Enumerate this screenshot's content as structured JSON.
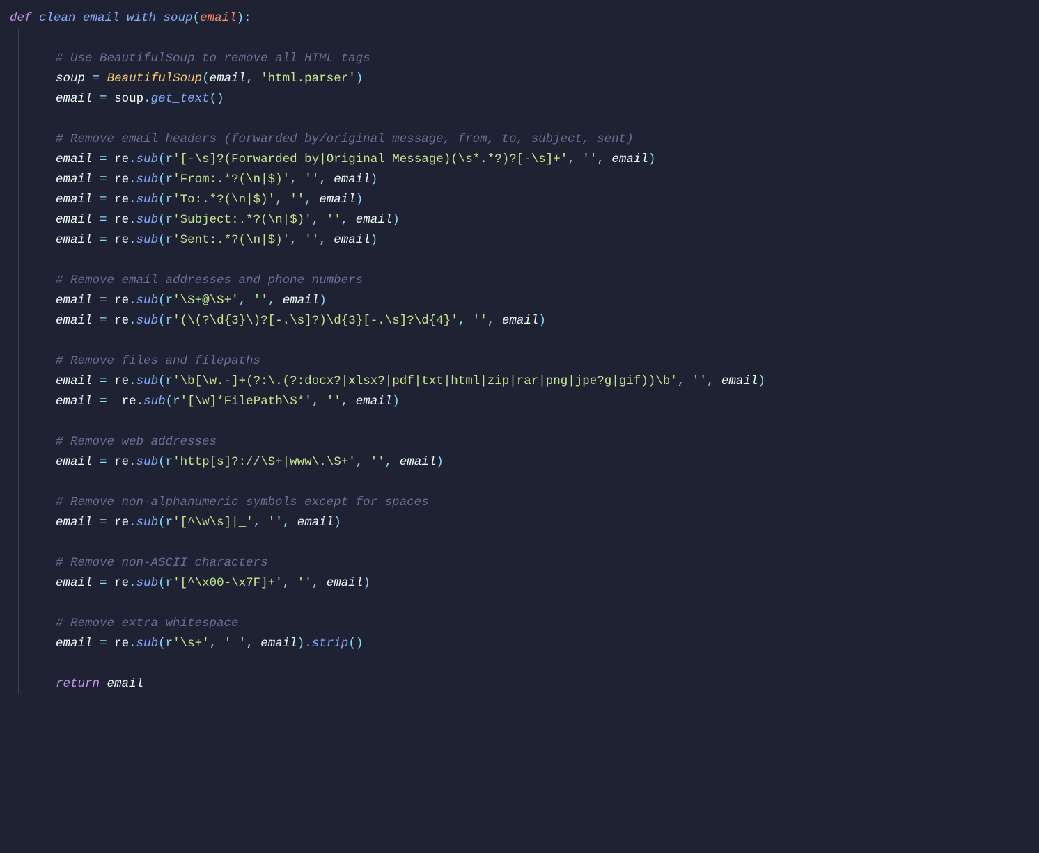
{
  "colors": {
    "background": "#1f2233",
    "keyword": "#c792ea",
    "function": "#82aaff",
    "class": "#ffcb6b",
    "param": "#f78c6c",
    "string": "#c3e88d",
    "punct": "#89ddff",
    "comment": "#697098",
    "text": "#eeffff"
  },
  "code": {
    "lang": "python",
    "def_kw": "def",
    "func_name": "clean_email_with_soup",
    "func_param": "email",
    "return_kw": "return",
    "return_var": "email",
    "lines": [
      {
        "type": "blank"
      },
      {
        "type": "comment",
        "text": "# Use BeautifulSoup to remove all HTML tags"
      },
      {
        "type": "assign",
        "lhs": "soup",
        "rhs_obj": "BeautifulSoup",
        "rhs_obj_kind": "cls",
        "args": [
          {
            "kind": "var",
            "v": "email"
          },
          {
            "kind": "str",
            "v": "'html.parser'"
          }
        ]
      },
      {
        "type": "assign",
        "lhs": "email",
        "rhs_obj": "soup",
        "rhs_method": "get_text",
        "args": []
      },
      {
        "type": "blank"
      },
      {
        "type": "comment",
        "text": "# Remove email headers (forwarded by/original message, from, to, subject, sent)"
      },
      {
        "type": "assign",
        "lhs": "email",
        "rhs_obj": "re",
        "rhs_method": "sub",
        "args": [
          {
            "kind": "rstr",
            "v": "'[-\\s]?(Forwarded by|Original Message)(\\s*.*?)?[-\\s]+'"
          },
          {
            "kind": "str",
            "v": "''"
          },
          {
            "kind": "var",
            "v": "email"
          }
        ]
      },
      {
        "type": "assign",
        "lhs": "email",
        "rhs_obj": "re",
        "rhs_method": "sub",
        "args": [
          {
            "kind": "rstr",
            "v": "'From:.*?(\\n|$)'"
          },
          {
            "kind": "str",
            "v": "''"
          },
          {
            "kind": "var",
            "v": "email"
          }
        ]
      },
      {
        "type": "assign",
        "lhs": "email",
        "rhs_obj": "re",
        "rhs_method": "sub",
        "args": [
          {
            "kind": "rstr",
            "v": "'To:.*?(\\n|$)'"
          },
          {
            "kind": "str",
            "v": "''"
          },
          {
            "kind": "var",
            "v": "email"
          }
        ]
      },
      {
        "type": "assign",
        "lhs": "email",
        "rhs_obj": "re",
        "rhs_method": "sub",
        "args": [
          {
            "kind": "rstr",
            "v": "'Subject:.*?(\\n|$)'"
          },
          {
            "kind": "str",
            "v": "''"
          },
          {
            "kind": "var",
            "v": "email"
          }
        ]
      },
      {
        "type": "assign",
        "lhs": "email",
        "rhs_obj": "re",
        "rhs_method": "sub",
        "args": [
          {
            "kind": "rstr",
            "v": "'Sent:.*?(\\n|$)'"
          },
          {
            "kind": "str",
            "v": "''"
          },
          {
            "kind": "var",
            "v": "email"
          }
        ]
      },
      {
        "type": "blank"
      },
      {
        "type": "comment",
        "text": "# Remove email addresses and phone numbers"
      },
      {
        "type": "assign",
        "lhs": "email",
        "rhs_obj": "re",
        "rhs_method": "sub",
        "args": [
          {
            "kind": "rstr",
            "v": "'\\S+@\\S+'"
          },
          {
            "kind": "str",
            "v": "''"
          },
          {
            "kind": "var",
            "v": "email"
          }
        ]
      },
      {
        "type": "assign",
        "lhs": "email",
        "rhs_obj": "re",
        "rhs_method": "sub",
        "args": [
          {
            "kind": "rstr",
            "v": "'(\\(?\\d{3}\\)?[-.\\s]?)\\d{3}[-.\\s]?\\d{4}'"
          },
          {
            "kind": "str",
            "v": "''"
          },
          {
            "kind": "var",
            "v": "email"
          }
        ]
      },
      {
        "type": "blank"
      },
      {
        "type": "comment",
        "text": "# Remove files and filepaths"
      },
      {
        "type": "assign",
        "lhs": "email",
        "rhs_obj": "re",
        "rhs_method": "sub",
        "args": [
          {
            "kind": "rstr",
            "v": "'\\b[\\w.-]+(?:\\.(?:docx?|xlsx?|pdf|txt|html|zip|rar|png|jpe?g|gif))\\b'"
          },
          {
            "kind": "str",
            "v": "''"
          },
          {
            "kind": "var",
            "v": "email"
          }
        ]
      },
      {
        "type": "assign",
        "lhs": "email",
        "extra_space": true,
        "rhs_obj": "re",
        "rhs_method": "sub",
        "args": [
          {
            "kind": "rstr",
            "v": "'[\\w]*FilePath\\S*'"
          },
          {
            "kind": "str",
            "v": "''"
          },
          {
            "kind": "var",
            "v": "email"
          }
        ]
      },
      {
        "type": "blank"
      },
      {
        "type": "comment",
        "text": "# Remove web addresses"
      },
      {
        "type": "assign",
        "lhs": "email",
        "rhs_obj": "re",
        "rhs_method": "sub",
        "args": [
          {
            "kind": "rstr",
            "v": "'http[s]?://\\S+|www\\.\\S+'"
          },
          {
            "kind": "str",
            "v": "''"
          },
          {
            "kind": "var",
            "v": "email"
          }
        ]
      },
      {
        "type": "blank"
      },
      {
        "type": "comment",
        "text": "# Remove non-alphanumeric symbols except for spaces"
      },
      {
        "type": "assign",
        "lhs": "email",
        "rhs_obj": "re",
        "rhs_method": "sub",
        "args": [
          {
            "kind": "rstr",
            "v": "'[^\\w\\s]|_'"
          },
          {
            "kind": "str",
            "v": "''"
          },
          {
            "kind": "var",
            "v": "email"
          }
        ]
      },
      {
        "type": "blank"
      },
      {
        "type": "comment",
        "text": "# Remove non-ASCII characters"
      },
      {
        "type": "assign",
        "lhs": "email",
        "rhs_obj": "re",
        "rhs_method": "sub",
        "args": [
          {
            "kind": "rstr",
            "v": "'[^\\x00-\\x7F]+'"
          },
          {
            "kind": "str",
            "v": "''"
          },
          {
            "kind": "var",
            "v": "email"
          }
        ]
      },
      {
        "type": "blank"
      },
      {
        "type": "comment",
        "text": "# Remove extra whitespace"
      },
      {
        "type": "assign",
        "lhs": "email",
        "rhs_obj": "re",
        "rhs_method": "sub",
        "args": [
          {
            "kind": "rstr",
            "v": "'\\s+'"
          },
          {
            "kind": "str",
            "v": "' '"
          },
          {
            "kind": "var",
            "v": "email"
          }
        ],
        "tail_method": "strip"
      },
      {
        "type": "blank"
      }
    ]
  }
}
